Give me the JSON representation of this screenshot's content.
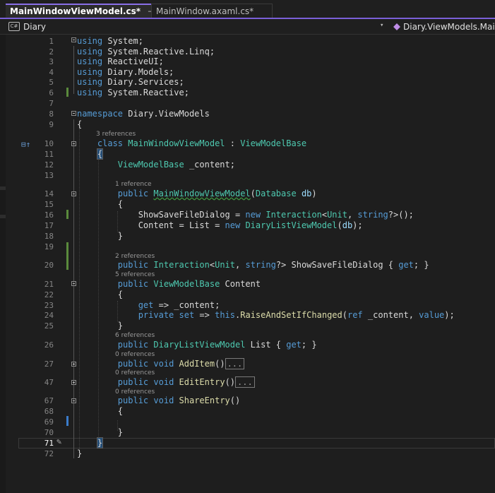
{
  "tabs": [
    {
      "label": "MainWindowViewModel.cs*",
      "active": true
    },
    {
      "label": "MainWindow.axaml.cs*",
      "active": false
    }
  ],
  "tab_icons": {
    "pin": "pin-icon",
    "close": "close-icon"
  },
  "navbar": {
    "project_badge": "C#",
    "project": "Diary",
    "dropdown_glyph": "▾",
    "scope": "Diary.ViewModels.MainWi"
  },
  "editor": {
    "current_line": 71,
    "lines": [
      {
        "n": "1",
        "code": "using System;"
      },
      {
        "n": "2",
        "code": "using System.Reactive.Linq;"
      },
      {
        "n": "3",
        "code": "using ReactiveUI;"
      },
      {
        "n": "4",
        "code": "using Diary.Models;"
      },
      {
        "n": "5",
        "code": "using Diary.Services;"
      },
      {
        "n": "6",
        "code": "using System.Reactive;"
      },
      {
        "n": "7",
        "code": ""
      },
      {
        "n": "8",
        "code": "namespace Diary.ViewModels"
      },
      {
        "n": "9",
        "code": "{"
      },
      {
        "n": "10",
        "code": "class MainWindowViewModel : ViewModelBase",
        "lens": "3 references"
      },
      {
        "n": "11",
        "code": "{"
      },
      {
        "n": "12",
        "code": "ViewModelBase _content;"
      },
      {
        "n": "13",
        "code": ""
      },
      {
        "n": "14",
        "code": "public MainWindowViewModel(Database db)",
        "lens": "1 reference"
      },
      {
        "n": "15",
        "code": "{"
      },
      {
        "n": "16",
        "code": "ShowSaveFileDialog = new Interaction<Unit, string?>();"
      },
      {
        "n": "17",
        "code": "Content = List = new DiaryListViewModel(db);"
      },
      {
        "n": "18",
        "code": "}"
      },
      {
        "n": "19",
        "code": ""
      },
      {
        "n": "20",
        "code": "public Interaction<Unit, string?> ShowSaveFileDialog { get; }",
        "lens": "2 references"
      },
      {
        "n": "21",
        "code": "public ViewModelBase Content",
        "lens": "5 references"
      },
      {
        "n": "22",
        "code": "{"
      },
      {
        "n": "23",
        "code": "get => _content;"
      },
      {
        "n": "24",
        "code": "private set => this.RaiseAndSetIfChanged(ref _content, value);"
      },
      {
        "n": "25",
        "code": "}"
      },
      {
        "n": "26",
        "code": "public DiaryListViewModel List { get; }",
        "lens": "6 references"
      },
      {
        "n": "27",
        "code": "public void AddItem()",
        "lens": "0 references",
        "collapsed": "..."
      },
      {
        "n": "47",
        "code": "public void EditEntry()",
        "lens": "0 references",
        "collapsed": "..."
      },
      {
        "n": "67",
        "code": "public void ShareEntry()",
        "lens": "0 references"
      },
      {
        "n": "68",
        "code": "{"
      },
      {
        "n": "69",
        "code": ""
      },
      {
        "n": "70",
        "code": "}"
      },
      {
        "n": "71",
        "code": "}"
      },
      {
        "n": "72",
        "code": "}"
      }
    ]
  },
  "colors": {
    "keyword": "#569cd6",
    "type": "#4ec9b0",
    "method": "#dcdcaa",
    "parameter": "#9cdcfe",
    "text": "#dadada",
    "accent": "#7a5fd8"
  }
}
